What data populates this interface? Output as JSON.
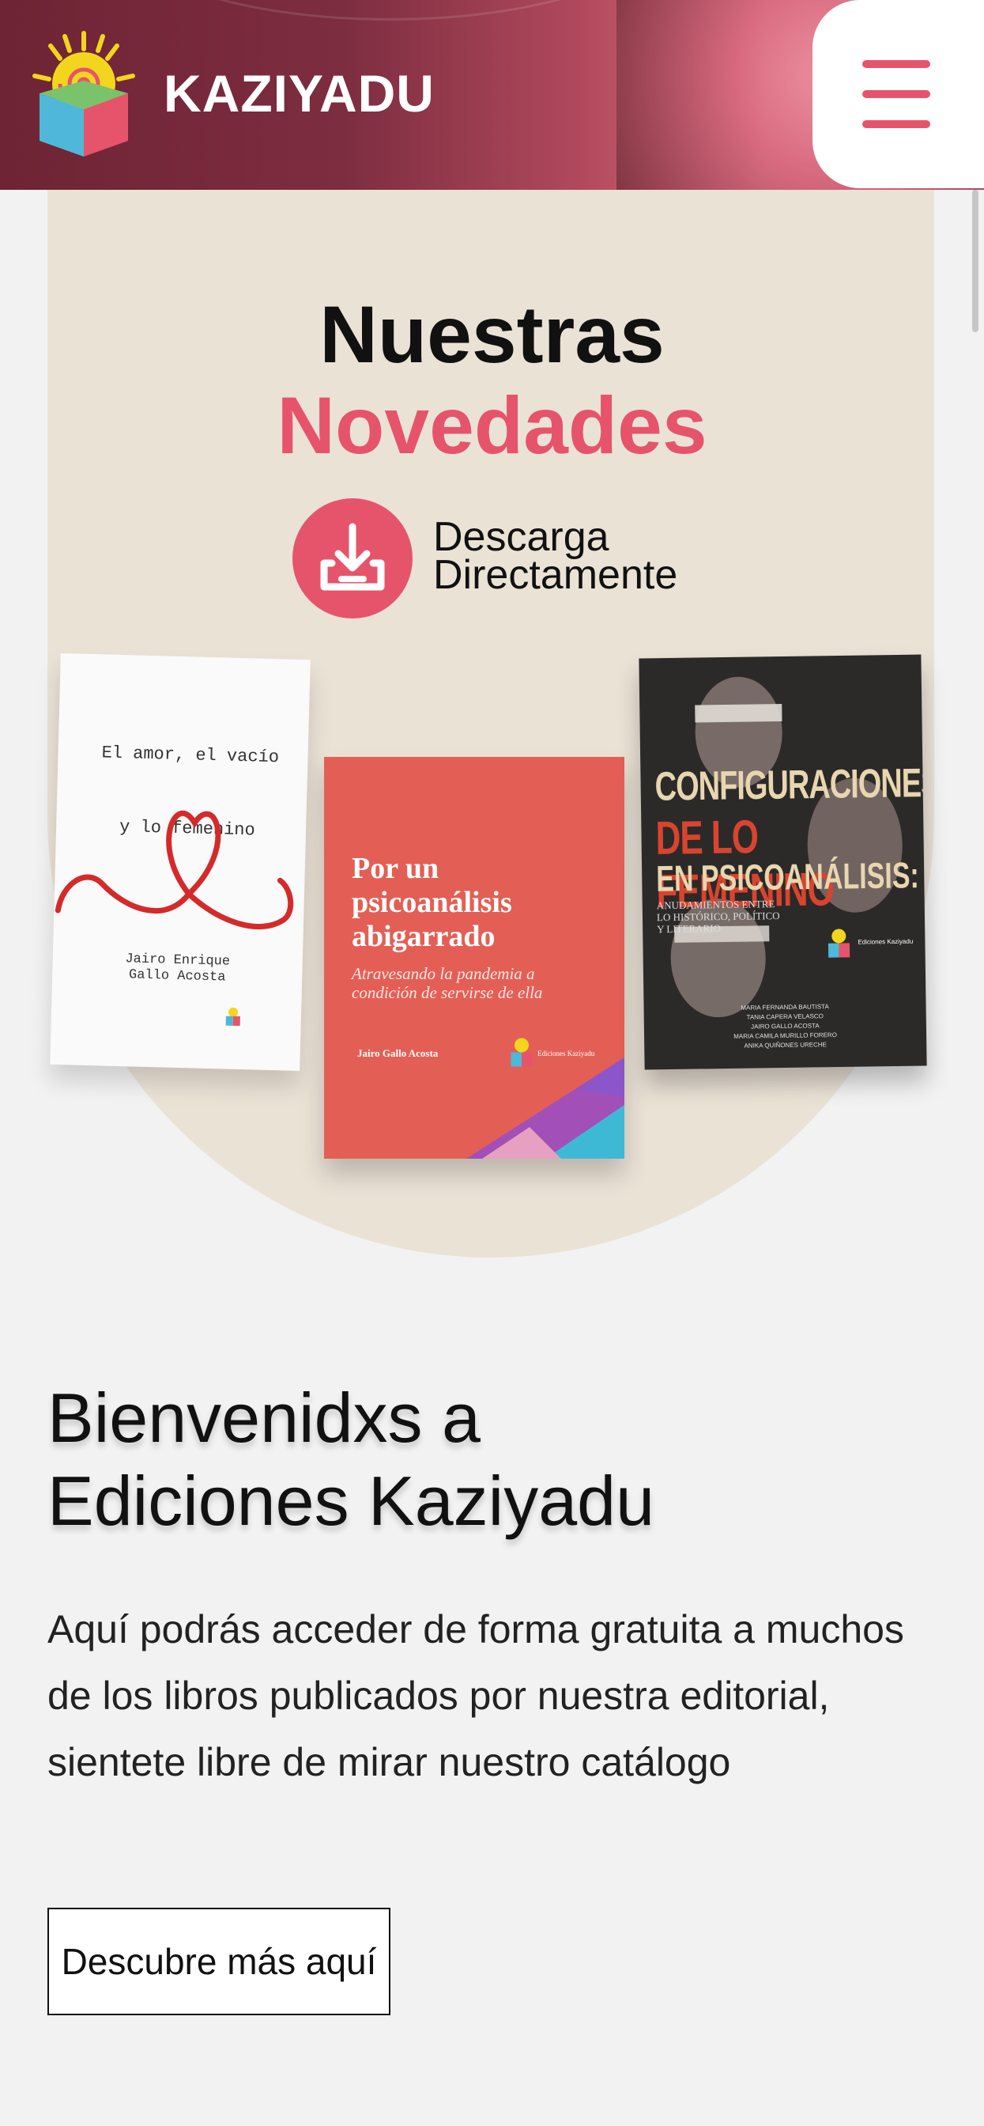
{
  "header": {
    "brand": "KAZIYADU",
    "menu_icon": "hamburger-menu-icon",
    "accent_color": "#e6546b"
  },
  "hero": {
    "title_line1": "Nuestras",
    "title_line2": "Novedades",
    "download_icon": "download-tray-icon",
    "download_line1": "Descarga",
    "download_line2": "Directamente",
    "books": [
      {
        "title_line1": "El amor, el vacío",
        "title_line2": "y lo femenino",
        "author_line1": "Jairo Enrique",
        "author_line2": "Gallo Acosta"
      },
      {
        "title_line1": "Por un",
        "title_line2": "psicoanálisis",
        "title_line3": "abigarrado",
        "subtitle_line1": "Atravesando la pandemia a",
        "subtitle_line2": "condición de servirse de ella",
        "author": "Jairo Gallo Acosta",
        "publisher": "Ediciones Kaziyadu"
      },
      {
        "title_line1": "CONFIGURACIONES",
        "title_line2": "DE LO FEMENINO",
        "title_line3": "EN PSICOANÁLISIS:",
        "subtitle_line1": "ANUDAMIENTOS ENTRE",
        "subtitle_line2": "LO HISTÓRICO, POLÍTICO",
        "subtitle_line3": "Y LITERARIO",
        "publisher": "Ediciones Kaziyadu",
        "authors": [
          "MARIA FERNANDA BAUTISTA",
          "TANIA CAPERA VELASCO",
          "JAIRO GALLO ACOSTA",
          "MARIA CAMILA MURILLO FORERO",
          "ANIKA QUIÑONES URECHE"
        ]
      }
    ]
  },
  "welcome": {
    "title_line1": "Bienvenidxs a",
    "title_line2": "Ediciones Kaziyadu",
    "text": "Aquí podrás acceder de forma gratuita a muchos de los libros publicados por nuestra editorial, sientete libre de mirar nuestro catálogo",
    "cta_label": "Descubre más aquí"
  }
}
